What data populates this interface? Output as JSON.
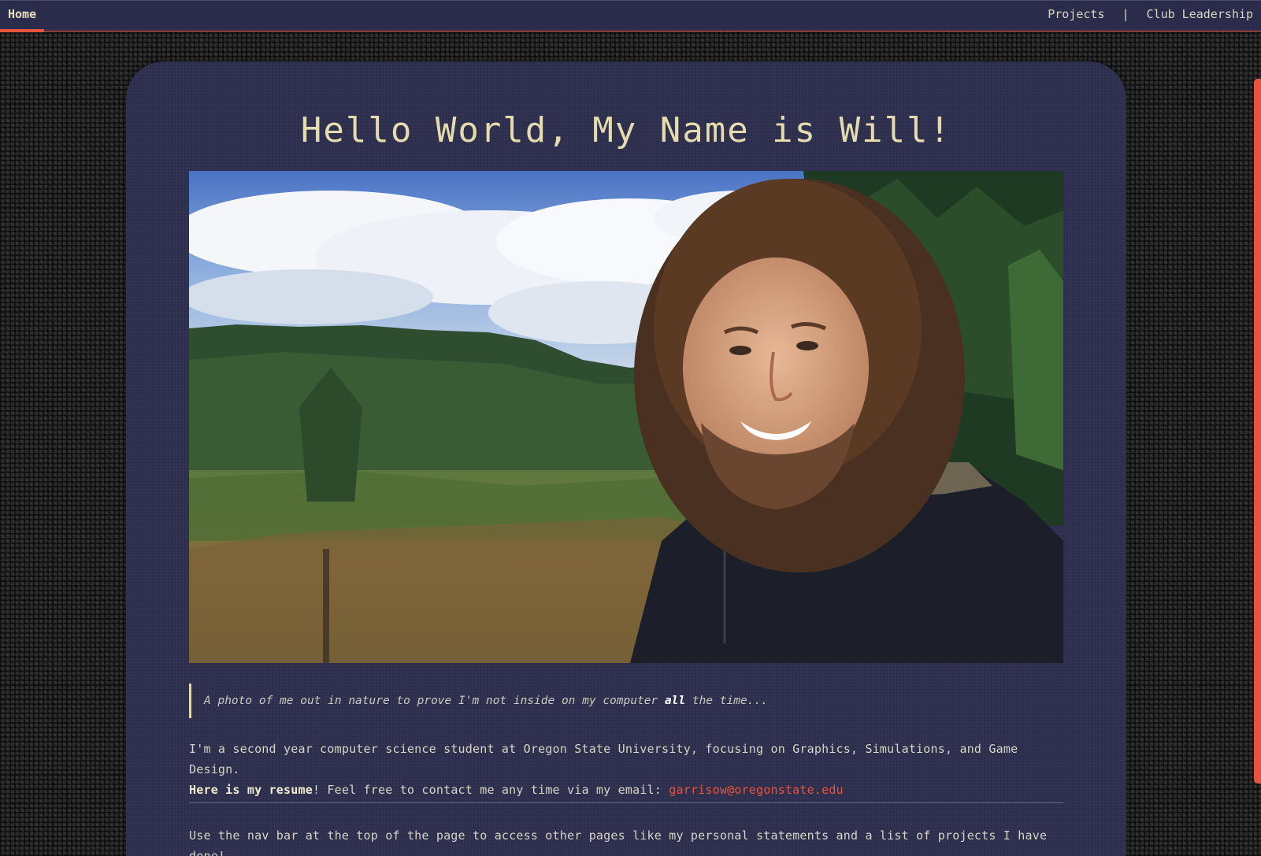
{
  "nav": {
    "home_label": "Home",
    "projects_label": "Projects",
    "separator": "|",
    "club_label": "Club Leadership"
  },
  "main": {
    "title": "Hello World, My Name is Will!",
    "caption": {
      "pre": "A photo of me out in nature to prove I'm not inside on my computer ",
      "bold": "all",
      "post": " the time..."
    },
    "bio": {
      "line1": "I'm a second year computer science student at Oregon State University, focusing on Graphics, Simulations, and Game Design.",
      "resume_link": "Here is my resume",
      "contact_text": "! Feel free to contact me any time via my email: ",
      "email": "garrisow@oregonstate.edu"
    },
    "nav_hint": "Use the nav bar at the top of the page to access other pages like my personal statements and a list of projects I have done!"
  },
  "colors": {
    "accent": "#e9543c",
    "title": "#e4dcae",
    "card_bg": "#2d2d4d",
    "nav_bg": "#2b2c4b"
  }
}
